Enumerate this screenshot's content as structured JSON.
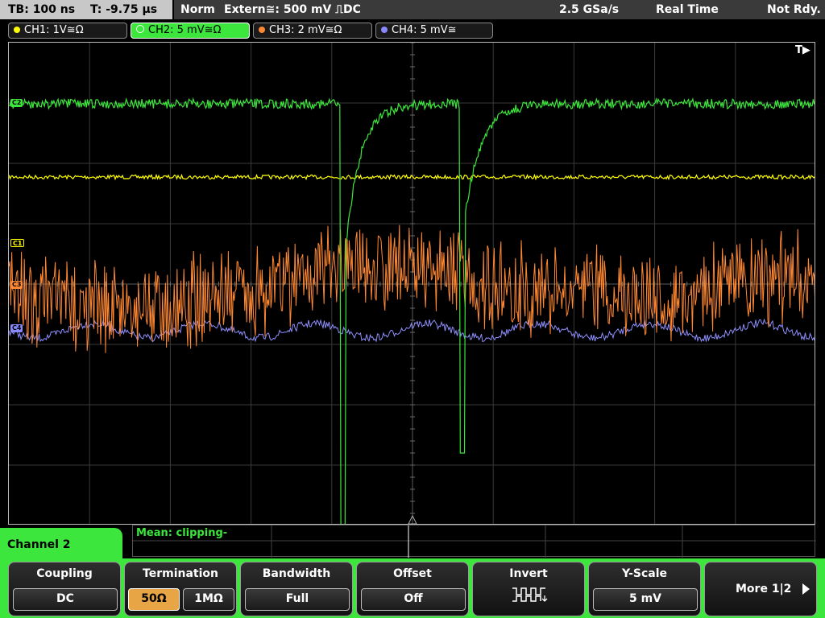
{
  "status": {
    "timebase": "TB: 100 ns",
    "trigger_time": "T: -9.75 µs",
    "mode": "Norm",
    "trigger_source": "Extern≅: 500 mV ⎍DC",
    "sample_rate": "2.5 GSa/s",
    "acq_mode": "Real Time",
    "state": "Not Rdy."
  },
  "channels": [
    {
      "label": "CH1: 1V≅Ω",
      "color": "#ffff00"
    },
    {
      "label": "CH2: 5 mV≅Ω",
      "color": "#3ce63c"
    },
    {
      "label": "CH3: 2 mV≅Ω",
      "color": "#ff8833"
    },
    {
      "label": "CH4: 5 mV≅",
      "color": "#8888ff"
    }
  ],
  "markers": {
    "trigger": "T▶",
    "ch2": "C2",
    "ch1": "C1",
    "ch3": "C3",
    "ch4": "C4"
  },
  "measurement": {
    "label": "Mean: clipping-"
  },
  "menu_title": "Channel 2",
  "softkeys": {
    "coupling": {
      "title": "Coupling",
      "value": "DC"
    },
    "termination": {
      "title": "Termination",
      "opt1": "50Ω",
      "opt2": "1MΩ"
    },
    "bandwidth": {
      "title": "Bandwidth",
      "value": "Full"
    },
    "offset": {
      "title": "Offset",
      "value": "Off"
    },
    "invert": {
      "title": "Invert",
      "icon": "invert-pulse-icon"
    },
    "yscale": {
      "title": "Y-Scale",
      "value": "5 mV"
    },
    "more": {
      "label": "More 1|2"
    }
  }
}
